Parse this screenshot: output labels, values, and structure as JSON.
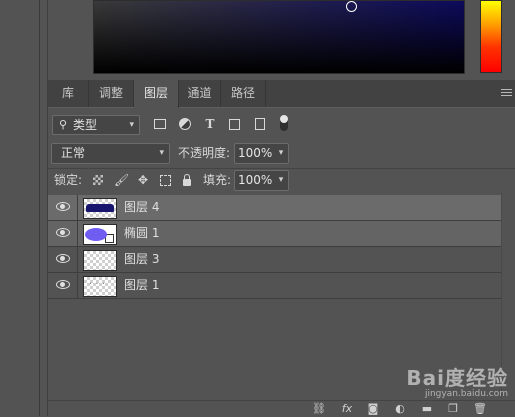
{
  "color_picker": {
    "field_color": "#0d0a5c",
    "hue_colors": [
      "#ffff00",
      "#ff9900",
      "#ff0000"
    ]
  },
  "tabs": [
    {
      "label": "库"
    },
    {
      "label": "调整"
    },
    {
      "label": "图层",
      "active": true
    },
    {
      "label": "通道"
    },
    {
      "label": "路径"
    }
  ],
  "filter": {
    "kind_label": "类型",
    "icons": [
      "image-filter-icon",
      "adjustment-filter-icon",
      "type-filter-icon",
      "shape-filter-icon",
      "smart-object-filter-icon"
    ]
  },
  "blend": {
    "mode": "正常",
    "opacity_label": "不透明度:",
    "opacity_value": "100%"
  },
  "lock": {
    "label": "锁定:",
    "fill_label": "填充:",
    "fill_value": "100%"
  },
  "layers": [
    {
      "name": "图层 4",
      "visible": true,
      "selected": true,
      "thumb": "dark-shape"
    },
    {
      "name": "椭圆 1",
      "visible": true,
      "selected": true,
      "thumb": "purple-ellipse"
    },
    {
      "name": "图层 3",
      "visible": true,
      "selected": false,
      "thumb": "transparent"
    },
    {
      "name": "图层 1",
      "visible": true,
      "selected": false,
      "thumb": "dotted"
    }
  ],
  "bottom_icons": [
    "link-icon",
    "fx-icon",
    "mask-icon",
    "adjustment-layer-icon",
    "folder-icon",
    "new-layer-icon",
    "trash-icon"
  ],
  "watermark": {
    "main": "Bai度经验",
    "sub": "jingyan.baidu.com"
  }
}
